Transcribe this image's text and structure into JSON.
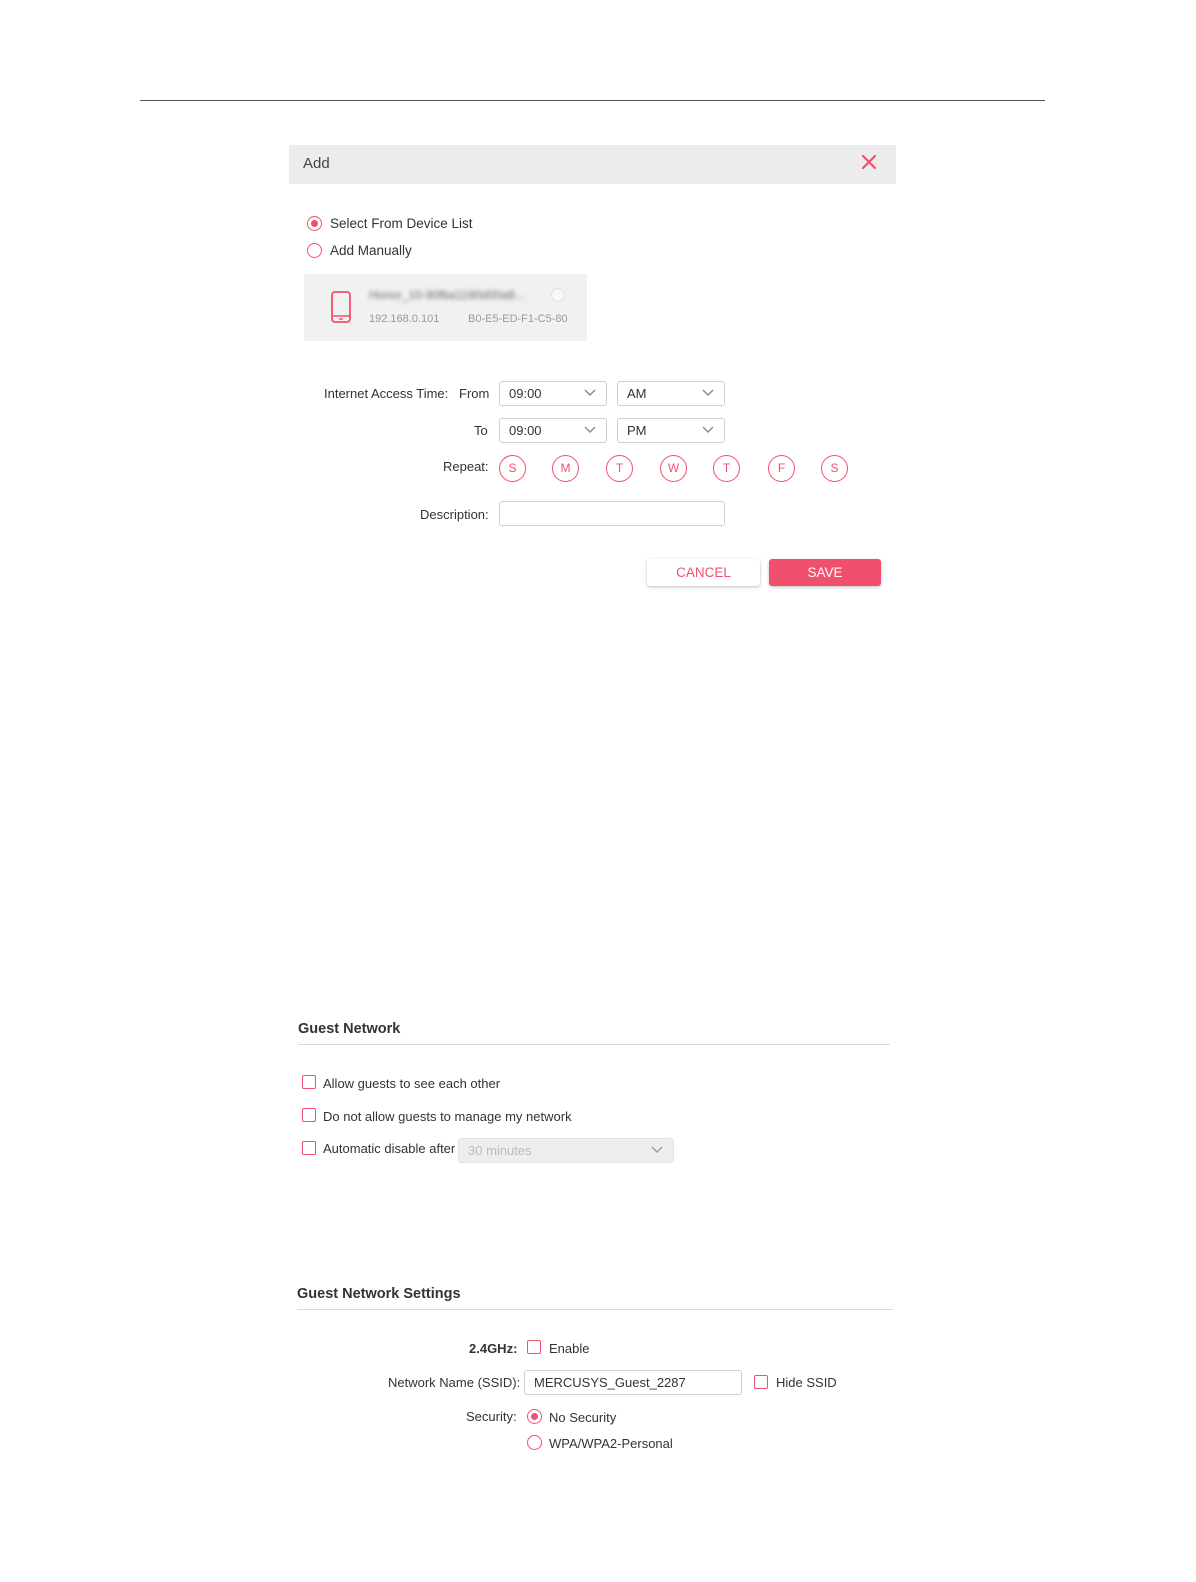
{
  "dialog": {
    "title": "Add",
    "source_options": [
      {
        "label": "Select From Device List",
        "selected": true
      },
      {
        "label": "Add Manually",
        "selected": false
      }
    ],
    "device": {
      "name": "Honor_10-90fba1180d00a8...",
      "ip": "192.168.0.101",
      "mac": "B0-E5-ED-F1-C5-80"
    },
    "access_time": {
      "label": "Internet Access Time:",
      "from_label": "From",
      "from_time": "09:00",
      "from_period": "AM",
      "to_label": "To",
      "to_time": "09:00",
      "to_period": "PM"
    },
    "repeat": {
      "label": "Repeat:",
      "days": [
        "S",
        "M",
        "T",
        "W",
        "T",
        "F",
        "S"
      ]
    },
    "description": {
      "label": "Description:",
      "value": ""
    },
    "cancel_label": "CANCEL",
    "save_label": "SAVE"
  },
  "guest_network": {
    "title": "Guest Network",
    "options": [
      {
        "label": "Allow guests to see each other",
        "checked": false
      },
      {
        "label": "Do not allow guests to manage my network",
        "checked": false
      },
      {
        "label": "Automatic disable after",
        "checked": false
      }
    ],
    "disable_after_value": "30 minutes"
  },
  "guest_settings": {
    "title": "Guest Network Settings",
    "band_label": "2.4GHz:",
    "enable_label": "Enable",
    "ssid_label": "Network Name (SSID):",
    "ssid_value": "MERCUSYS_Guest_2287",
    "hide_ssid_label": "Hide SSID",
    "security_label": "Security:",
    "security_options": [
      {
        "label": "No Security",
        "selected": true
      },
      {
        "label": "WPA/WPA2-Personal",
        "selected": false
      }
    ]
  },
  "colors": {
    "accent": "#f0506e",
    "header_bg": "#ececec",
    "card_bg": "#f1f1f1"
  }
}
